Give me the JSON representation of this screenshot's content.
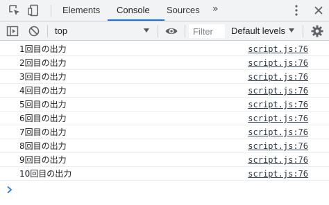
{
  "tabs": {
    "items": [
      {
        "label": "Elements"
      },
      {
        "label": "Console"
      },
      {
        "label": "Sources"
      }
    ],
    "active": "Console",
    "more": "»"
  },
  "toolbar": {
    "context": "top",
    "filter_placeholder": "Filter",
    "levels": "Default levels"
  },
  "console": {
    "messages": [
      {
        "text": "1回目の出力",
        "source": "script.js:76"
      },
      {
        "text": "2回目の出力",
        "source": "script.js:76"
      },
      {
        "text": "3回目の出力",
        "source": "script.js:76"
      },
      {
        "text": "4回目の出力",
        "source": "script.js:76"
      },
      {
        "text": "5回目の出力",
        "source": "script.js:76"
      },
      {
        "text": "6回目の出力",
        "source": "script.js:76"
      },
      {
        "text": "7回目の出力",
        "source": "script.js:76"
      },
      {
        "text": "8回目の出力",
        "source": "script.js:76"
      },
      {
        "text": "9回目の出力",
        "source": "script.js:76"
      },
      {
        "text": "10回目の出力",
        "source": "script.js:76"
      }
    ]
  },
  "colors": {
    "accent": "#1a73e8",
    "toolbar_bg": "#f1f3f4",
    "border": "#cacdd1",
    "prompt": "#1a73e8"
  },
  "icons": [
    "inspect-element-icon",
    "device-toolbar-icon",
    "more-tabs-icon",
    "kebab-menu-icon",
    "close-icon",
    "sidebar-toggle-icon",
    "clear-console-icon",
    "dropdown-arrow-icon",
    "eye-icon",
    "gear-icon",
    "prompt-chevron-icon"
  ]
}
